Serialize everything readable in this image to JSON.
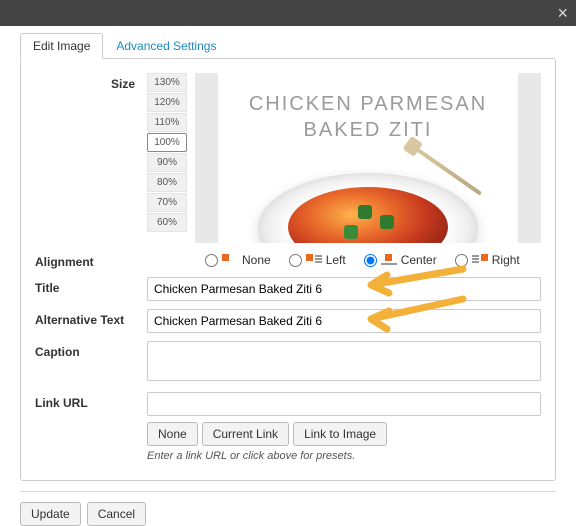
{
  "tabs": {
    "edit": "Edit Image",
    "advanced": "Advanced Settings"
  },
  "size": {
    "label": "Size",
    "options": [
      "130%",
      "120%",
      "110%",
      "100%",
      "90%",
      "80%",
      "70%",
      "60%"
    ],
    "selected": "100%"
  },
  "preview": {
    "line1": "CHICKEN PARMESAN",
    "line2": "BAKED ZITI"
  },
  "alignment": {
    "label": "Alignment",
    "options": {
      "none": "None",
      "left": "Left",
      "center": "Center",
      "right": "Right"
    },
    "selected": "center"
  },
  "title": {
    "label": "Title",
    "value": "Chicken Parmesan Baked Ziti 6"
  },
  "alt": {
    "label": "Alternative Text",
    "value": "Chicken Parmesan Baked Ziti 6"
  },
  "caption": {
    "label": "Caption",
    "value": ""
  },
  "linkurl": {
    "label": "Link URL",
    "value": "",
    "buttons": {
      "none": "None",
      "current": "Current Link",
      "image": "Link to Image"
    },
    "hint": "Enter a link URL or click above for presets."
  },
  "footer": {
    "update": "Update",
    "cancel": "Cancel"
  },
  "close_icon": "×"
}
